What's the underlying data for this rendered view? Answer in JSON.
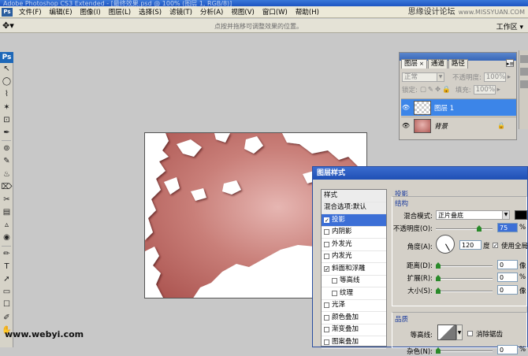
{
  "window": {
    "title": "Adobe Photoshop CS3 Extended - [最终效果.psd @ 100% (图层 1, RGB/8)]"
  },
  "menubar": {
    "app_icon": "Ps",
    "items": [
      "文件(F)",
      "编辑(E)",
      "图像(I)",
      "图层(L)",
      "选择(S)",
      "滤镜(T)",
      "分析(A)",
      "视图(V)",
      "窗口(W)",
      "帮助(H)"
    ]
  },
  "watermark": {
    "site": "思缘设计论坛",
    "url": "www.MISSYUAN.COM",
    "bottom": "www.webyi.com"
  },
  "options_bar": {
    "tool_icon": "move-icon",
    "hint": "点按并拖移可调整效果的位置。",
    "workspace": "工作区"
  },
  "toolbox": {
    "logo": "Ps",
    "tools": [
      "↖",
      "◯",
      "⌇",
      "✶",
      "⊡",
      "✒",
      "⊚",
      "✎",
      "♨",
      "⌦",
      "✂",
      "▤",
      "▵",
      "◉",
      "✏",
      "T",
      "➚",
      "▭",
      "☐",
      "✐",
      "✋"
    ]
  },
  "layers_panel": {
    "tabs": [
      {
        "label": "图层",
        "close": "×"
      },
      {
        "label": "通道"
      },
      {
        "label": "路径"
      }
    ],
    "blend_mode": "正常",
    "opacity_label": "不透明度:",
    "opacity_value": "100%",
    "lock_label": "锁定:",
    "fill_label": "填充:",
    "fill_value": "100%",
    "layers": [
      {
        "name": "图层 1",
        "selected": true
      },
      {
        "name": "背景",
        "locked": true
      }
    ]
  },
  "layer_style_dialog": {
    "title": "图层样式",
    "styles": [
      {
        "label": "样式",
        "checkbox": false,
        "header": true
      },
      {
        "label": "混合选项:默认",
        "checkbox": false,
        "header": true
      },
      {
        "label": "投影",
        "checkbox": true,
        "checked": true,
        "active": true
      },
      {
        "label": "内阴影",
        "checkbox": true,
        "checked": false
      },
      {
        "label": "外发光",
        "checkbox": true,
        "checked": false
      },
      {
        "label": "内发光",
        "checkbox": true,
        "checked": false
      },
      {
        "label": "斜面和浮雕",
        "checkbox": true,
        "checked": true
      },
      {
        "label": "等高线",
        "checkbox": true,
        "checked": false,
        "sub": true
      },
      {
        "label": "纹理",
        "checkbox": true,
        "checked": false,
        "sub": true
      },
      {
        "label": "光泽",
        "checkbox": true,
        "checked": false
      },
      {
        "label": "颜色叠加",
        "checkbox": true,
        "checked": false
      },
      {
        "label": "渐变叠加",
        "checkbox": true,
        "checked": false
      },
      {
        "label": "图案叠加",
        "checkbox": true,
        "checked": false
      }
    ],
    "drop_shadow": {
      "section": "投影",
      "structure": "结构",
      "blend_mode_label": "混合模式:",
      "blend_mode_value": "正片叠底",
      "shadow_color": "#000000",
      "opacity_label": "不透明度(O):",
      "opacity_value": "75",
      "opacity_unit": "%",
      "angle_label": "角度(A):",
      "angle_value": "120",
      "angle_unit": "度",
      "global_light_label": "使用全局",
      "global_light_checked": true,
      "distance_label": "距离(D):",
      "distance_value": "0",
      "distance_unit": "像",
      "spread_label": "扩展(R):",
      "spread_value": "0",
      "spread_unit": "%",
      "size_label": "大小(S):",
      "size_value": "0",
      "size_unit": "像",
      "quality": "品质",
      "contour_label": "等高线:",
      "antialias_label": "消除锯齿",
      "noise_label": "杂色(N):",
      "noise_value": "0",
      "noise_unit": "%"
    }
  }
}
